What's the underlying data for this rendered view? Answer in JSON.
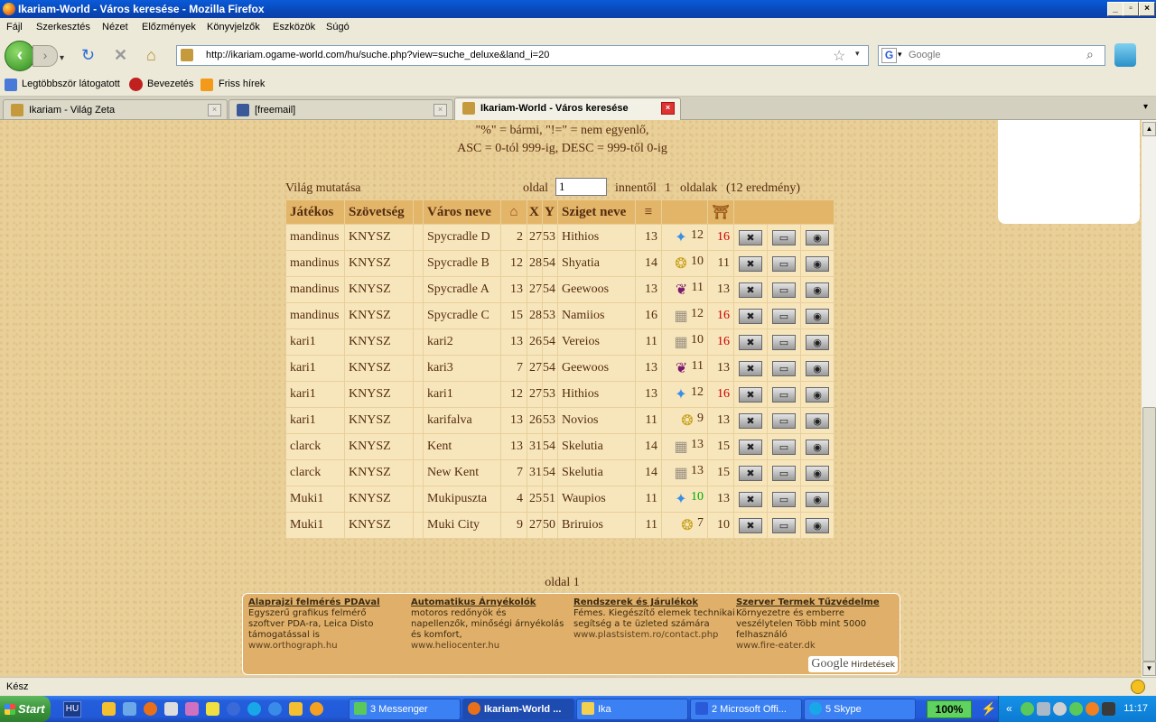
{
  "window": {
    "title": "Ikariam-World - Város keresése - Mozilla Firefox"
  },
  "menu": [
    "Fájl",
    "Szerkesztés",
    "Nézet",
    "Előzmények",
    "Könyvjelzők",
    "Eszközök",
    "Súgó"
  ],
  "address": {
    "url": "http://ikariam.ogame-world.com/hu/suche.php?view=suche_deluxe&land_i=20"
  },
  "search": {
    "placeholder": "Google",
    "engine_letter": "G"
  },
  "bookmarks": [
    "Legtöbbször látogatott",
    "Bevezetés",
    "Friss hírek"
  ],
  "tabs": [
    {
      "label": "Ikariam - Világ Zeta"
    },
    {
      "label": "[freemail]"
    },
    {
      "label": "Ikariam-World - Város keresése"
    }
  ],
  "page": {
    "hint_line1": "\"%\" = bármi, \"!=\" = nem egyenlő,",
    "hint_line2": "ASC = 0-tól 999-ig, DESC = 999-től 0-ig",
    "show_world": "Világ mutatása",
    "pager_label": "oldal",
    "page_value": "1",
    "pager_from": "innentől",
    "pager_total": "1",
    "pager_pages": "oldalak",
    "pager_results": "(12 eredmény)",
    "bottom_page": "oldal 1"
  },
  "table": {
    "headers": [
      "Játékos",
      "Szövetség",
      "",
      "Város neve",
      "",
      "X",
      "Y",
      "Sziget neve",
      "",
      "",
      ""
    ],
    "rows": [
      {
        "player": "mandinus",
        "alliance": "KNYSZ",
        "city": "Spycradle D",
        "size": "2",
        "x": "27",
        "y": "53",
        "island": "Hithios",
        "wood": "13",
        "res": "crystal",
        "res_lvl": "12",
        "res_lvl_color": "",
        "wonder": "16",
        "wonder_red": true
      },
      {
        "player": "mandinus",
        "alliance": "KNYSZ",
        "city": "Spycradle B",
        "size": "12",
        "x": "28",
        "y": "54",
        "island": "Shyatia",
        "wood": "14",
        "res": "sulfur",
        "res_lvl": "10",
        "res_lvl_color": "",
        "wonder": "11",
        "wonder_red": false
      },
      {
        "player": "mandinus",
        "alliance": "KNYSZ",
        "city": "Spycradle A",
        "size": "13",
        "x": "27",
        "y": "54",
        "island": "Geewoos",
        "wood": "13",
        "res": "wine",
        "res_lvl": "11",
        "res_lvl_color": "",
        "wonder": "13",
        "wonder_red": false
      },
      {
        "player": "mandinus",
        "alliance": "KNYSZ",
        "city": "Spycradle C",
        "size": "15",
        "x": "28",
        "y": "53",
        "island": "Namiios",
        "wood": "16",
        "res": "marble",
        "res_lvl": "12",
        "res_lvl_color": "",
        "wonder": "16",
        "wonder_red": true
      },
      {
        "player": "kari1",
        "alliance": "KNYSZ",
        "city": "kari2",
        "size": "13",
        "x": "26",
        "y": "54",
        "island": "Vereios",
        "wood": "11",
        "res": "marble",
        "res_lvl": "10",
        "res_lvl_color": "",
        "wonder": "16",
        "wonder_red": true
      },
      {
        "player": "kari1",
        "alliance": "KNYSZ",
        "city": "kari3",
        "size": "7",
        "x": "27",
        "y": "54",
        "island": "Geewoos",
        "wood": "13",
        "res": "wine",
        "res_lvl": "11",
        "res_lvl_color": "",
        "wonder": "13",
        "wonder_red": false
      },
      {
        "player": "kari1",
        "alliance": "KNYSZ",
        "city": "kari1",
        "size": "12",
        "x": "27",
        "y": "53",
        "island": "Hithios",
        "wood": "13",
        "res": "crystal",
        "res_lvl": "12",
        "res_lvl_color": "",
        "wonder": "16",
        "wonder_red": true
      },
      {
        "player": "kari1",
        "alliance": "KNYSZ",
        "city": "karifalva",
        "size": "13",
        "x": "26",
        "y": "53",
        "island": "Novios",
        "wood": "11",
        "res": "sulfur",
        "res_lvl": "9",
        "res_lvl_color": "",
        "wonder": "13",
        "wonder_red": false
      },
      {
        "player": "clarck",
        "alliance": "KNYSZ",
        "city": "Kent",
        "size": "13",
        "x": "31",
        "y": "54",
        "island": "Skelutia",
        "wood": "14",
        "res": "marble",
        "res_lvl": "13",
        "res_lvl_color": "",
        "wonder": "15",
        "wonder_red": false
      },
      {
        "player": "clarck",
        "alliance": "KNYSZ",
        "city": "New Kent",
        "size": "7",
        "x": "31",
        "y": "54",
        "island": "Skelutia",
        "wood": "14",
        "res": "marble",
        "res_lvl": "13",
        "res_lvl_color": "",
        "wonder": "15",
        "wonder_red": false
      },
      {
        "player": "Muki1",
        "alliance": "KNYSZ",
        "city": "Mukipuszta",
        "size": "4",
        "x": "25",
        "y": "51",
        "island": "Waupios",
        "wood": "11",
        "res": "crystal",
        "res_lvl": "10",
        "res_lvl_color": "green",
        "wonder": "13",
        "wonder_red": false
      },
      {
        "player": "Muki1",
        "alliance": "KNYSZ",
        "city": "Muki City",
        "size": "9",
        "x": "27",
        "y": "50",
        "island": "Briruios",
        "wood": "11",
        "res": "sulfur",
        "res_lvl": "7",
        "res_lvl_color": "",
        "wonder": "10",
        "wonder_red": false
      }
    ]
  },
  "ads": [
    {
      "title": "Alaprajzi felmérés PDAval",
      "text": "Egyszerű grafikus felmérő szoftver PDA-ra, Leica Disto támogatással is",
      "url": "www.orthograph.hu"
    },
    {
      "title": "Automatikus Árnyékolók",
      "text": "motoros redőnyök és napellenzők, minőségi árnyékolás és komfort,",
      "url": "www.heliocenter.hu"
    },
    {
      "title": "Rendszerek és Járulékok",
      "text": "Fémes. Kiegészítő elemek technikai segítség a te üzleted számára",
      "url": "www.plastsistem.ro/contact.php"
    },
    {
      "title": "Szerver Termek Tűzvédelme",
      "text": "Környezetre és emberre veszélytelen Több mint 5000 felhasználó",
      "url": "www.fire-eater.dk"
    }
  ],
  "ads_label": {
    "google": "Google",
    "hirdetesek": "Hirdetések"
  },
  "status": {
    "text": "Kész"
  },
  "taskbar": {
    "start": "Start",
    "lang": "HU",
    "tasks": [
      {
        "label": "3 Messenger"
      },
      {
        "label": "Ikariam-World ..."
      },
      {
        "label": "Ika"
      },
      {
        "label": "2 Microsoft Offi..."
      },
      {
        "label": "5 Skype"
      }
    ],
    "battery": "100%",
    "clock": "11:17"
  },
  "colors": {
    "page_bg": "#e9cf98",
    "table_header": "#e3b569",
    "table_cell": "#f7e6bc",
    "text": "#542c0f",
    "red": "#cc0000"
  }
}
